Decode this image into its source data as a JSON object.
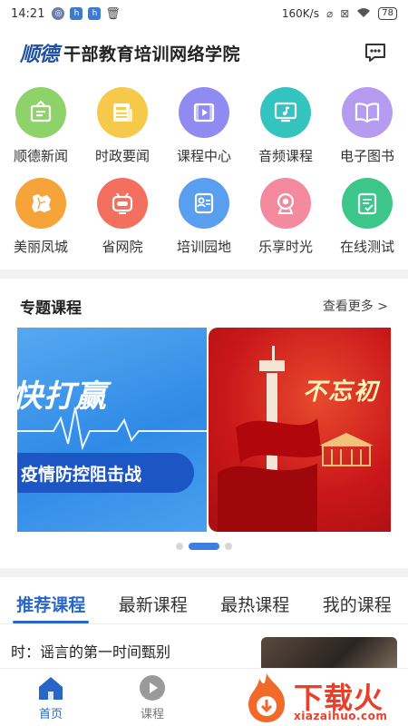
{
  "status_bar": {
    "time": "14:21",
    "speed": "160K/s",
    "battery": "78"
  },
  "header": {
    "logo_text": "顺德",
    "title": "干部教育培训网络学院",
    "message_icon": "chat-bubble-icon"
  },
  "grid": [
    {
      "label": "顺德新闻",
      "icon": "notice-board-icon",
      "color": "#8ed26a"
    },
    {
      "label": "时政要闻",
      "icon": "newspaper-icon",
      "color": "#f6c94a"
    },
    {
      "label": "课程中心",
      "icon": "video-play-icon",
      "color": "#8f8bf0"
    },
    {
      "label": "音频课程",
      "icon": "music-monitor-icon",
      "color": "#33c4c0"
    },
    {
      "label": "电子图书",
      "icon": "open-book-icon",
      "color": "#b59cf0"
    },
    {
      "label": "美丽凤城",
      "icon": "map-region-icon",
      "color": "#f6a43a"
    },
    {
      "label": "省网院",
      "icon": "robot-icon",
      "color": "#f36f5e"
    },
    {
      "label": "培训园地",
      "icon": "training-card-icon",
      "color": "#5a9ef0"
    },
    {
      "label": "乐享时光",
      "icon": "webcam-icon",
      "color": "#f38aa0"
    },
    {
      "label": "在线测试",
      "icon": "checklist-icon",
      "color": "#3cc68a"
    }
  ],
  "featured": {
    "title": "专题课程",
    "more": "查看更多 >",
    "banner1_headline": "快打赢",
    "banner1_pill": "疫情防控阻击战",
    "banner2_text": "不忘初",
    "pager_active_index": 1
  },
  "tabs": [
    {
      "label": "推荐课程",
      "active": true
    },
    {
      "label": "最新课程",
      "active": false
    },
    {
      "label": "最热课程",
      "active": false
    },
    {
      "label": "我的课程",
      "active": false
    }
  ],
  "news": {
    "title": "时：谣言的第一时间甄别"
  },
  "bottom_nav": [
    {
      "label": "首页",
      "icon": "home-icon",
      "active": true
    },
    {
      "label": "课程",
      "icon": "play-circle-icon",
      "active": false
    }
  ],
  "watermark": {
    "text": "下载火",
    "url": "xiazaihuo.com"
  }
}
